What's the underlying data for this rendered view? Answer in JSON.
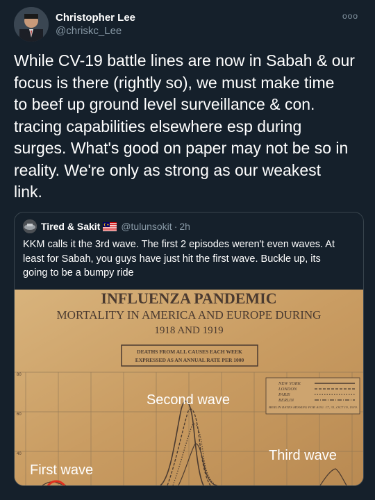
{
  "author": {
    "display_name": "Christopher Lee",
    "handle": "@chriskc_Lee"
  },
  "more_menu": "ooo",
  "tweet": {
    "text": "While CV-19 battle lines are now in Sabah & our\nfocus is there (rightly so), we must make time\nto beef up ground level surveillance & con.\ntracing capabilities elsewhere esp during\nsurges. What's good on paper may not be so in\nreality.  We're only as strong as our weakest\nlink."
  },
  "quoted_tweet": {
    "display_name": "Tired & Sakit",
    "flag_icon": "malaysia-flag-icon",
    "handle": "@tulunsokit",
    "separator": "·",
    "time": "2h",
    "text": "KKM calls it the 3rd wave. The first 2 episodes weren't even waves. At\nleast for Sabah, you guys have just hit the first wave. Buckle up, its\ngoing to be a bumpy ride",
    "image": {
      "title_line1": "INFLUENZA        PANDEMIC",
      "title_line2": "MORTALITY IN AMERICA AND EUROPE DURING",
      "title_line3": "1918 AND 1919",
      "box_line1": "DEATHS FROM ALL CAUSES EACH WEEK",
      "box_line2": "EXPRESSED AS AN ANNUAL RATE PER 1000",
      "legend": [
        "NEW YORK",
        "LONDON",
        "PARIS",
        "BERLIN"
      ],
      "legend_note": "BERLIN RATES MISSING FOR AUG. 17, 31, OCT 19, 1919.",
      "y_ticks": [
        "80",
        "60",
        "40"
      ],
      "label_second_wave": "Second wave",
      "label_first_wave": "First wave",
      "label_third_wave": "Third wave"
    }
  },
  "colors": {
    "background": "#15202b",
    "secondary_text": "#8899a6",
    "border": "#38444d",
    "poster": "#cfa56e"
  }
}
